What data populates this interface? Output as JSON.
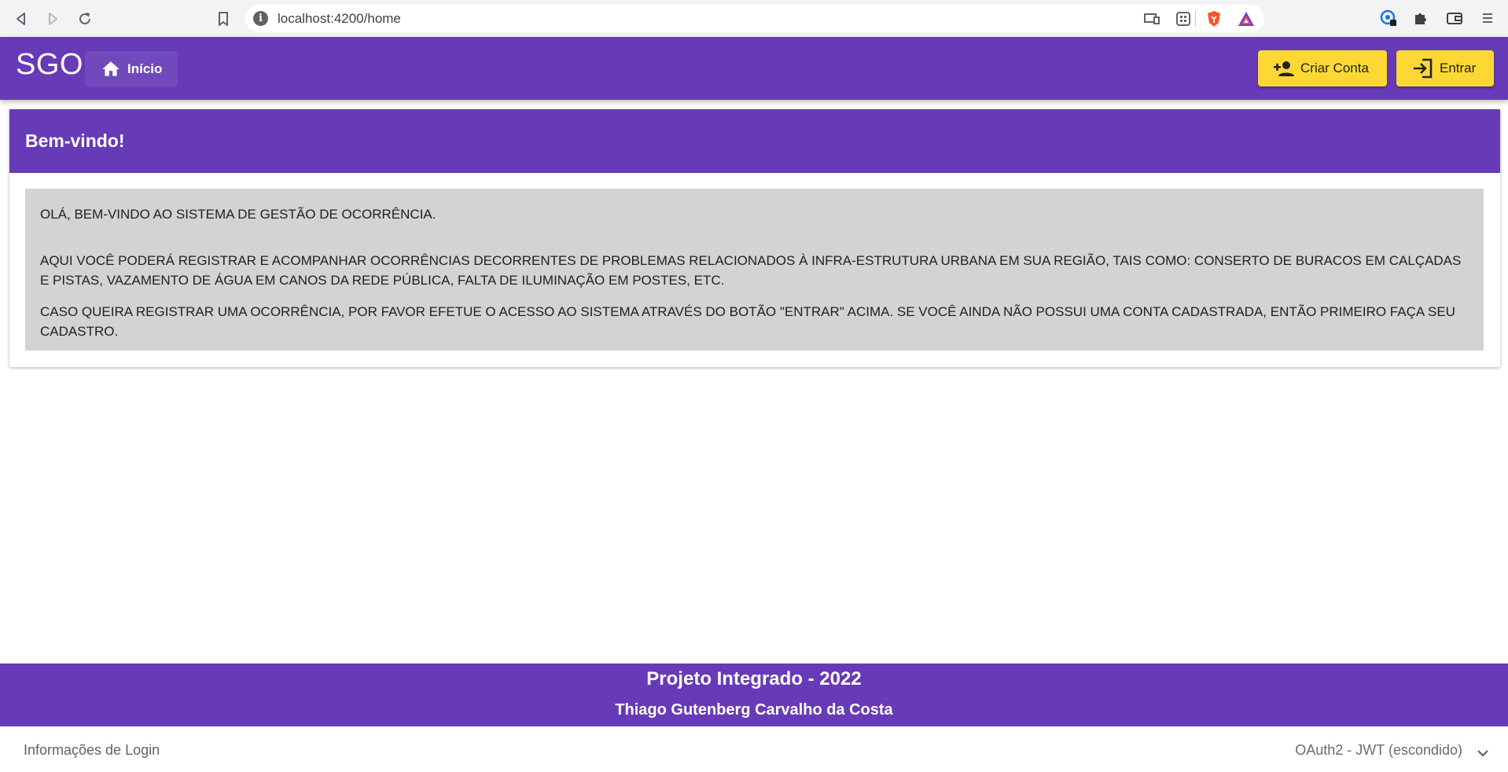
{
  "browser": {
    "url": "localhost:4200/home",
    "nav_icons": [
      "back-icon",
      "forward-icon",
      "reload-icon"
    ],
    "extension_icons": [
      "profile-sync-icon",
      "puzzle-icon",
      "wallet-icon",
      "menu-icon"
    ]
  },
  "toolbar": {
    "brand": "SGO",
    "home_label": "Início",
    "create_account_label": "Criar Conta",
    "login_label": "Entrar"
  },
  "card": {
    "title": "Bem-vindo!",
    "paragraph_1": "OLÁ, BEM-VINDO AO SISTEMA DE GESTÃO DE OCORRÊNCIA.",
    "paragraph_2": "AQUI VOCÊ PODERÁ REGISTRAR E ACOMPANHAR OCORRÊNCIAS DECORRENTES DE PROBLEMAS RELACIONADOS À INFRA-ESTRUTURA URBANA EM SUA REGIÃO, TAIS COMO: CONSERTO DE BURACOS EM CALÇADAS E PISTAS, VAZAMENTO DE ÁGUA EM CANOS DA REDE PÚBLICA, FALTA DE ILUMINAÇÃO EM POSTES, ETC.",
    "paragraph_3": "CASO QUEIRA REGISTRAR UMA OCORRÊNCIA, POR FAVOR EFETUE O ACESSO AO SISTEMA ATRAVÉS DO BOTÃO \"ENTRAR\" ACIMA. SE VOCÊ AINDA NÃO POSSUI UMA CONTA CADASTRADA, ENTÃO PRIMEIRO FAÇA SEU CADASTRO."
  },
  "footer": {
    "title": "Projeto Integrado - 2022",
    "author": "Thiago Gutenberg Carvalho da Costa"
  },
  "login_info": {
    "title": "Informações de Login",
    "description": "OAuth2 - JWT (escondido)"
  },
  "colors": {
    "primary": "#673ab7",
    "accent": "#fdd835",
    "content_background": "#d3d3d3"
  }
}
